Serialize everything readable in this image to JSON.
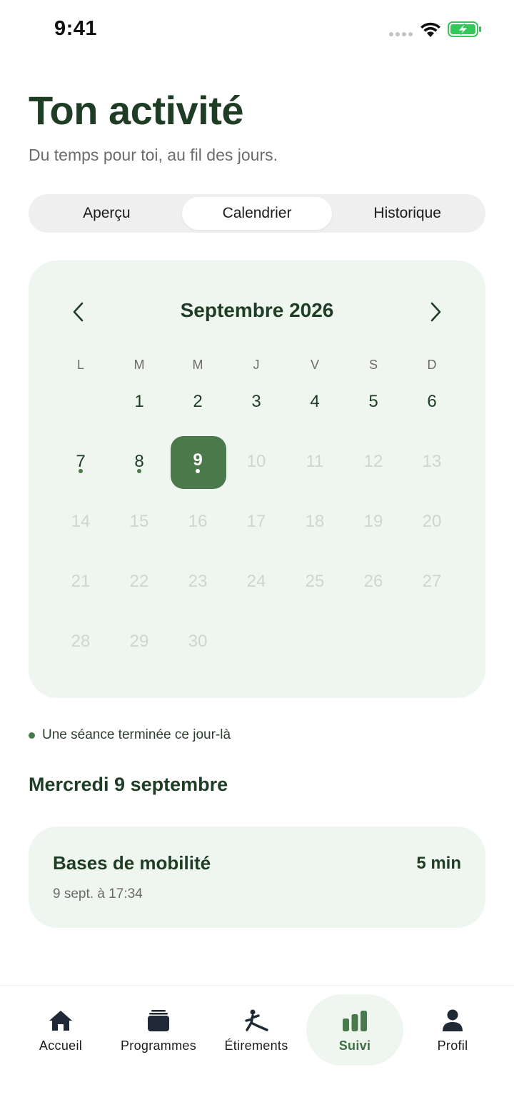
{
  "status_bar": {
    "time": "9:41",
    "icons": [
      "signal-dots-icon",
      "wifi-icon",
      "battery-charging-icon"
    ],
    "battery_color": "#34c759"
  },
  "header": {
    "title": "Ton activité",
    "subtitle": "Du temps pour toi, au fil des jours."
  },
  "tabs": [
    {
      "label": "Aperçu",
      "active": false
    },
    {
      "label": "Calendrier",
      "active": true
    },
    {
      "label": "Historique",
      "active": false
    }
  ],
  "calendar": {
    "month_label": "Septembre 2026",
    "prev_icon": "chevron-left-icon",
    "next_icon": "chevron-right-icon",
    "weekdays": [
      "L",
      "M",
      "M",
      "J",
      "V",
      "S",
      "D"
    ],
    "leading_blanks": 1,
    "days": [
      {
        "n": "1",
        "state": "normal",
        "dot": false
      },
      {
        "n": "2",
        "state": "normal",
        "dot": false
      },
      {
        "n": "3",
        "state": "normal",
        "dot": false
      },
      {
        "n": "4",
        "state": "normal",
        "dot": false
      },
      {
        "n": "5",
        "state": "normal",
        "dot": false
      },
      {
        "n": "6",
        "state": "normal",
        "dot": false
      },
      {
        "n": "7",
        "state": "normal",
        "dot": true
      },
      {
        "n": "8",
        "state": "normal",
        "dot": true
      },
      {
        "n": "9",
        "state": "selected",
        "dot": true
      },
      {
        "n": "10",
        "state": "muted",
        "dot": false
      },
      {
        "n": "11",
        "state": "muted",
        "dot": false
      },
      {
        "n": "12",
        "state": "muted",
        "dot": false
      },
      {
        "n": "13",
        "state": "muted",
        "dot": false
      },
      {
        "n": "14",
        "state": "muted",
        "dot": false
      },
      {
        "n": "15",
        "state": "muted",
        "dot": false
      },
      {
        "n": "16",
        "state": "muted",
        "dot": false
      },
      {
        "n": "17",
        "state": "muted",
        "dot": false
      },
      {
        "n": "18",
        "state": "muted",
        "dot": false
      },
      {
        "n": "19",
        "state": "muted",
        "dot": false
      },
      {
        "n": "20",
        "state": "muted",
        "dot": false
      },
      {
        "n": "21",
        "state": "muted",
        "dot": false
      },
      {
        "n": "22",
        "state": "muted",
        "dot": false
      },
      {
        "n": "23",
        "state": "muted",
        "dot": false
      },
      {
        "n": "24",
        "state": "muted",
        "dot": false
      },
      {
        "n": "25",
        "state": "muted",
        "dot": false
      },
      {
        "n": "26",
        "state": "muted",
        "dot": false
      },
      {
        "n": "27",
        "state": "muted",
        "dot": false
      },
      {
        "n": "28",
        "state": "muted",
        "dot": false
      },
      {
        "n": "29",
        "state": "muted",
        "dot": false
      },
      {
        "n": "30",
        "state": "muted",
        "dot": false
      }
    ]
  },
  "legend": {
    "text": "Une séance terminée ce jour-là"
  },
  "selected_day": {
    "heading": "Mercredi 9 septembre",
    "session": {
      "title": "Bases de mobilité",
      "duration": "5 min",
      "date": "9 sept. à 17:34"
    }
  },
  "colors": {
    "primary_dark": "#1f3d25",
    "accent": "#4a7a4c",
    "card_bg": "#eff6ef",
    "muted_text": "#6b6b6b"
  },
  "tab_bar": [
    {
      "label": "Accueil",
      "icon": "home-icon",
      "active": false
    },
    {
      "label": "Programmes",
      "icon": "stack-icon",
      "active": false
    },
    {
      "label": "Étirements",
      "icon": "stretching-person-icon",
      "active": false
    },
    {
      "label": "Suivi",
      "icon": "bar-chart-icon",
      "active": true
    },
    {
      "label": "Profil",
      "icon": "person-icon",
      "active": false
    }
  ]
}
